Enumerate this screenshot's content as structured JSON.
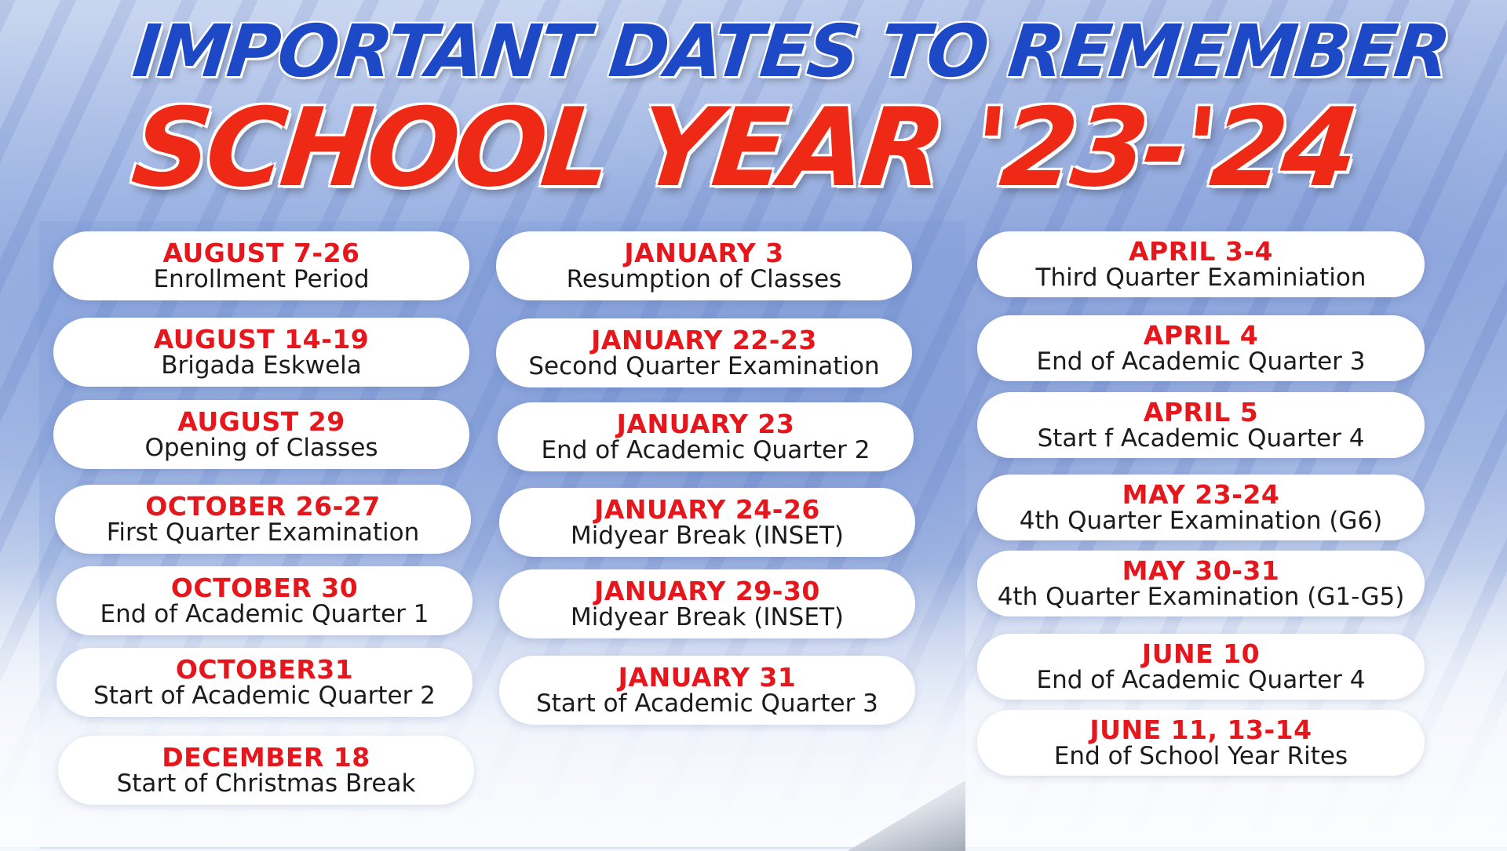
{
  "header": {
    "title": "IMPORTANT DATES TO REMEMBER",
    "subtitle": "SCHOOL YEAR '23-'24"
  },
  "columns": [
    {
      "items": [
        {
          "date": "AUGUST 7-26",
          "event": "Enrollment Period"
        },
        {
          "date": "AUGUST  14-19",
          "event": "Brigada Eskwela"
        },
        {
          "date": "AUGUST 29",
          "event": "Opening  of Classes"
        },
        {
          "date": "OCTOBER 26-27",
          "event": "First Quarter Examination"
        },
        {
          "date": "OCTOBER 30",
          "event": "End of Academic Quarter 1"
        },
        {
          "date": "OCTOBER31",
          "event": "Start of Academic Quarter 2"
        },
        {
          "date": "DECEMBER 18",
          "event": "Start of Christmas Break"
        }
      ]
    },
    {
      "items": [
        {
          "date": "JANUARY 3",
          "event": "Resumption of Classes"
        },
        {
          "date": "JANUARY 22-23",
          "event": "Second Quarter Examination"
        },
        {
          "date": "JANUARY 23",
          "event": "End of Academic Quarter 2"
        },
        {
          "date": "JANUARY 24-26",
          "event": "Midyear Break (INSET)"
        },
        {
          "date": "JANUARY 29-30",
          "event": "Midyear Break (INSET)"
        },
        {
          "date": "JANUARY 31",
          "event": "Start of Academic Quarter 3"
        }
      ]
    },
    {
      "items": [
        {
          "date": "APRIL 3-4",
          "event": "Third Quarter Examiniation"
        },
        {
          "date": "APRIL 4",
          "event": "End of Academic Quarter 3"
        },
        {
          "date": "APRIL 5",
          "event": "Start f Academic Quarter 4"
        },
        {
          "date": "MAY 23-24",
          "event": "4th Quarter Examination  (G6)"
        },
        {
          "date": "MAY 30-31",
          "event": "4th Quarter Examination (G1-G5)"
        },
        {
          "date": "JUNE 10",
          "event": "End of Academic Quarter 4"
        },
        {
          "date": "JUNE 11, 13-14",
          "event": "End of School Year Rites"
        }
      ]
    }
  ],
  "colors": {
    "title": "#1d49c6",
    "subtitle": "#ee2a16",
    "date": "#e5171c",
    "event": "#1b1b1b",
    "card": "#ffffff"
  }
}
